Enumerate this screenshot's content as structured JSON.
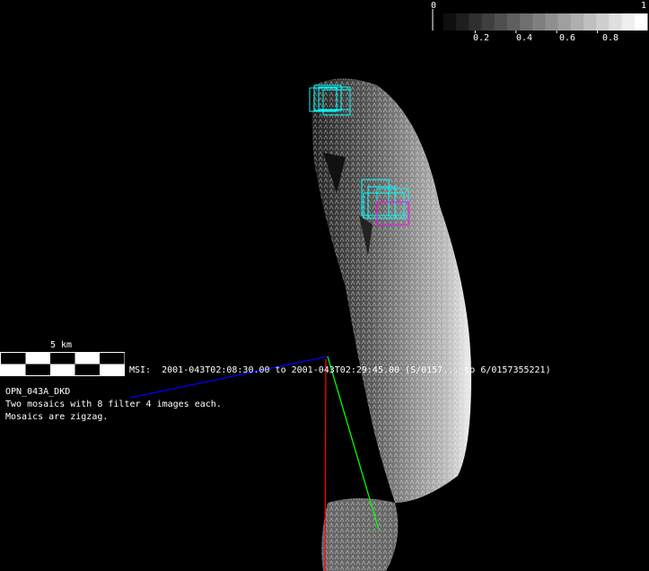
{
  "colorbar": {
    "min_label": "0",
    "max_label": "1",
    "tick_labels": [
      "0.2",
      "0.4",
      "0.6",
      "0.8"
    ],
    "steps": 16
  },
  "scale_bar": {
    "label": "5 km"
  },
  "msi_label": "MSI:  2001-043T02:08:30.00 to 2001-043T02:29:45.00 (S/0157... to 6/0157355221)",
  "observation": {
    "name": "OPN_043A_DKD",
    "line1": "Two mosaics with 8 filter 4 images each.",
    "line2": "Mosaics are zigzag."
  },
  "colors": {
    "footprints": "#00ffff",
    "axis_x": "#0000ff",
    "axis_y": "#00ff00",
    "axis_z": "#ff0000",
    "highlight": "#ff00ff"
  }
}
